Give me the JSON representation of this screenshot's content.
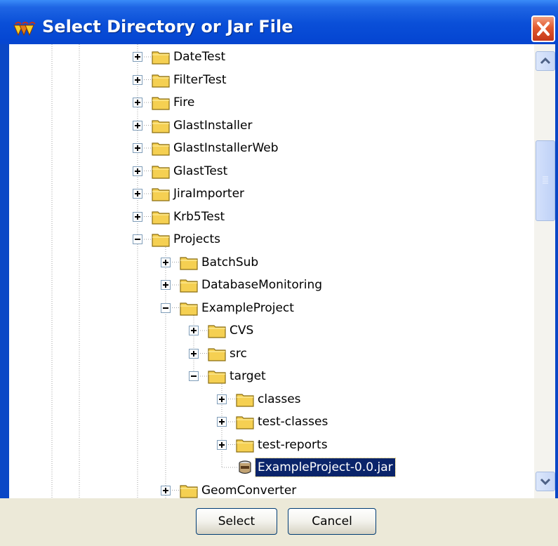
{
  "window": {
    "title": "Select Directory or Jar File",
    "title_icon": "java-cup-icon",
    "close_icon": "close-icon"
  },
  "tree": {
    "items": [
      {
        "label": "DateTest",
        "level": 0,
        "expander": "plus",
        "icon": "folder-icon",
        "selected": false
      },
      {
        "label": "FilterTest",
        "level": 0,
        "expander": "plus",
        "icon": "folder-icon",
        "selected": false
      },
      {
        "label": "Fire",
        "level": 0,
        "expander": "plus",
        "icon": "folder-icon",
        "selected": false
      },
      {
        "label": "GlastInstaller",
        "level": 0,
        "expander": "plus",
        "icon": "folder-icon",
        "selected": false
      },
      {
        "label": "GlastInstallerWeb",
        "level": 0,
        "expander": "plus",
        "icon": "folder-icon",
        "selected": false
      },
      {
        "label": "GlastTest",
        "level": 0,
        "expander": "plus",
        "icon": "folder-icon",
        "selected": false
      },
      {
        "label": "JiraImporter",
        "level": 0,
        "expander": "plus",
        "icon": "folder-icon",
        "selected": false
      },
      {
        "label": "Krb5Test",
        "level": 0,
        "expander": "plus",
        "icon": "folder-icon",
        "selected": false
      },
      {
        "label": "Projects",
        "level": 0,
        "expander": "minus",
        "icon": "folder-icon",
        "selected": false
      },
      {
        "label": "BatchSub",
        "level": 1,
        "expander": "plus",
        "icon": "folder-icon",
        "selected": false
      },
      {
        "label": "DatabaseMonitoring",
        "level": 1,
        "expander": "plus",
        "icon": "folder-icon",
        "selected": false
      },
      {
        "label": "ExampleProject",
        "level": 1,
        "expander": "minus",
        "icon": "folder-icon",
        "selected": false
      },
      {
        "label": "CVS",
        "level": 2,
        "expander": "plus",
        "icon": "folder-icon",
        "selected": false
      },
      {
        "label": "src",
        "level": 2,
        "expander": "plus",
        "icon": "folder-icon",
        "selected": false
      },
      {
        "label": "target",
        "level": 2,
        "expander": "minus",
        "icon": "folder-icon",
        "selected": false
      },
      {
        "label": "classes",
        "level": 3,
        "expander": "plus",
        "icon": "folder-icon",
        "selected": false
      },
      {
        "label": "test-classes",
        "level": 3,
        "expander": "plus",
        "icon": "folder-icon",
        "selected": false
      },
      {
        "label": "test-reports",
        "level": 3,
        "expander": "plus",
        "icon": "folder-icon",
        "selected": false
      },
      {
        "label": "ExampleProject-0.0.jar",
        "level": 3,
        "expander": "none",
        "icon": "jar-file-icon",
        "selected": true
      },
      {
        "label": "GeomConverter",
        "level": 1,
        "expander": "plus",
        "icon": "folder-icon",
        "selected": false
      }
    ]
  },
  "scrollbar": {
    "up_icon": "scroll-up-arrow-icon",
    "down_icon": "scroll-down-arrow-icon",
    "thumb_grip_icon": "grip-icon"
  },
  "buttons": {
    "select_label": "Select",
    "cancel_label": "Cancel"
  },
  "colors": {
    "titlebar": "#0a47c6",
    "selection": "#0a246a",
    "folder": "#f5d052",
    "dialog_bg": "#ece9d8"
  }
}
